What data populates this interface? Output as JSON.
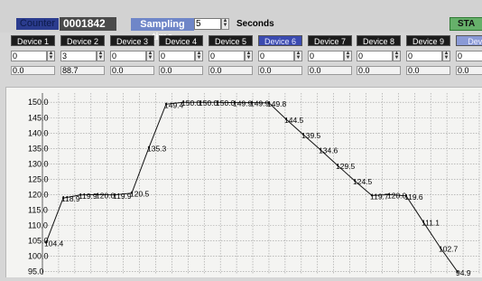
{
  "header": {
    "counter_label": "Counter",
    "counter_value": "0001842",
    "sampling_label": "Sampling time",
    "sampling_value": "5",
    "seconds_label": "Seconds",
    "start_label": "STA"
  },
  "devices": [
    {
      "label": "Device 1",
      "setpoint": "0",
      "reading": "0.0"
    },
    {
      "label": "Device 2",
      "setpoint": "3",
      "reading": "88.7"
    },
    {
      "label": "Device 3",
      "setpoint": "0",
      "reading": "0.0"
    },
    {
      "label": "Device 4",
      "setpoint": "0",
      "reading": "0.0"
    },
    {
      "label": "Device 5",
      "setpoint": "0",
      "reading": "0.0"
    },
    {
      "label": "Device 6",
      "setpoint": "0",
      "reading": "0.0"
    },
    {
      "label": "Device 7",
      "setpoint": "0",
      "reading": "0.0"
    },
    {
      "label": "Device 8",
      "setpoint": "0",
      "reading": "0.0"
    },
    {
      "label": "Device 9",
      "setpoint": "0",
      "reading": "0.0"
    },
    {
      "label": "Devic",
      "setpoint": "0",
      "reading": "0.0"
    }
  ],
  "colors": {
    "chart_line": "#111111",
    "grid": "#9a9a9a",
    "selected_device": "#3b4bb0"
  },
  "chart_data": {
    "type": "line",
    "title": "",
    "xlabel": "",
    "ylabel": "",
    "grid": true,
    "ylim": [
      94,
      153
    ],
    "yticks": [
      "95.0",
      "100.0",
      "105.0",
      "110.0",
      "115.0",
      "120.0",
      "125.0",
      "130.0",
      "135.0",
      "140.0",
      "145.0",
      "150.0"
    ],
    "x": [
      0,
      1,
      2,
      3,
      4,
      5,
      6,
      7,
      8,
      9,
      10,
      11,
      12,
      13,
      14,
      15,
      16,
      17,
      18,
      19,
      20,
      21,
      22,
      23,
      24,
      25,
      26,
      27
    ],
    "series": [
      {
        "values": [
          104.4,
          118.9,
          119.9,
          120.0,
          119.9,
          120.5,
          135.3,
          149.4,
          150.0,
          150.0,
          150.0,
          149.9,
          149.9,
          149.8,
          144.5,
          139.5,
          134.6,
          129.5,
          124.5,
          119.7,
          120.0,
          119.6,
          111.1,
          102.7,
          94.9
        ],
        "labels": [
          "104.4",
          "118.9",
          "119.9",
          "120.0",
          "119.9",
          "120.5",
          "135.3",
          "149.4",
          "150.0",
          "150.0",
          "150.0",
          "149.9",
          "149.9",
          "149.8",
          "144.5",
          "139.5",
          "134.6",
          "129.5",
          "124.5",
          "119.7",
          "120.0",
          "119.6",
          "111.1",
          "102.7",
          "94.9"
        ]
      }
    ]
  }
}
